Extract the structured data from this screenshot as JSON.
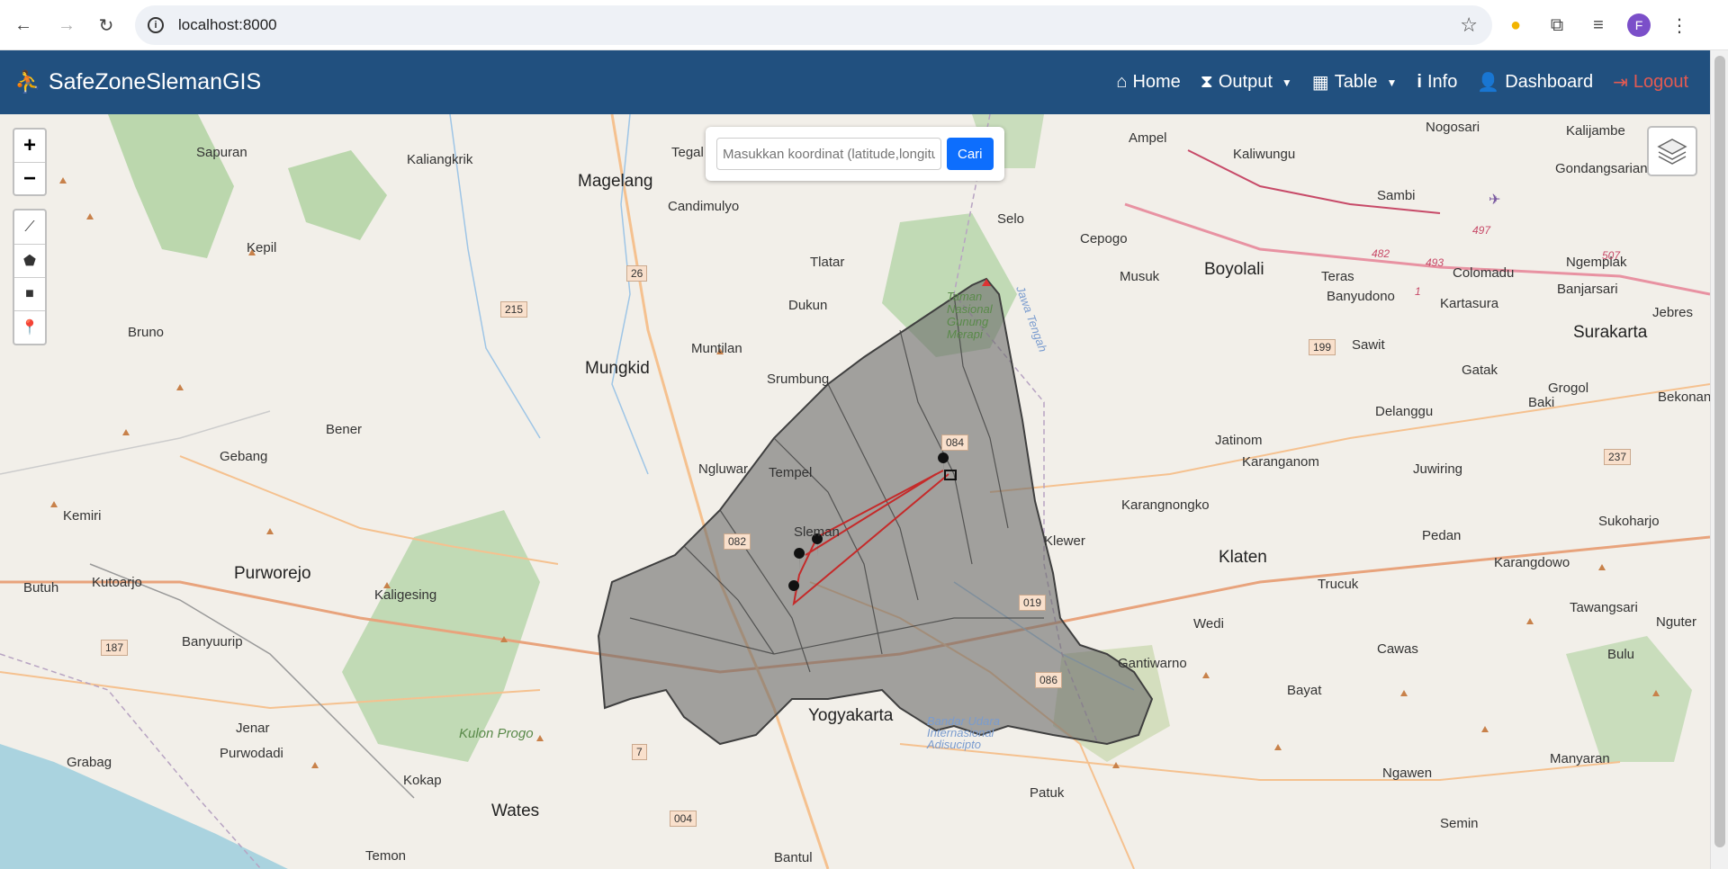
{
  "browser": {
    "url": "localhost:8000",
    "profile_initial": "F"
  },
  "navbar": {
    "brand": "SafeZoneSlemanGIS",
    "items": [
      {
        "label": "Home",
        "icon": "home-icon"
      },
      {
        "label": "Output",
        "icon": "hourglass-icon",
        "dropdown": true
      },
      {
        "label": "Table",
        "icon": "table-icon",
        "dropdown": true
      },
      {
        "label": "Info",
        "icon": "info-icon"
      },
      {
        "label": "Dashboard",
        "icon": "user-icon"
      },
      {
        "label": "Logout",
        "icon": "logout-icon"
      }
    ],
    "logout_color": "#e35a52",
    "bg_color": "#21507f"
  },
  "search": {
    "placeholder": "Masukkan koordinat (latitude,longitude)",
    "button": "Cari"
  },
  "map": {
    "zoom_in": "+",
    "zoom_out": "−",
    "labels": [
      "Sapuran",
      "Kaliangkrik",
      "Magelang",
      "Tegal",
      "Candimulyo",
      "Selo",
      "Cepogo",
      "Ampel",
      "Kaliwungu",
      "Nogosari",
      "Kalijambe",
      "Gondangsariangrejo",
      "Sambi",
      "Ngemplak",
      "Colomadu",
      "Banjarsari",
      "Jebres",
      "Surakarta",
      "Boyolali",
      "Teras",
      "Banyudono",
      "Kartasura",
      "Musuk",
      "Kepil",
      "Bruno",
      "Tlatar",
      "Dukun",
      "Mungkid",
      "Muntilan",
      "Srumbung",
      "Bener",
      "Gebang",
      "Kemiri",
      "Purworejo",
      "Kutoarjo",
      "Butuh",
      "Kaligesing",
      "Banyuurip",
      "Jenar",
      "Purwodadi",
      "Grabag",
      "Kokap",
      "Wates",
      "Temon",
      "Ngluwar",
      "Tempel",
      "Sleman",
      "Yogyakarta",
      "Bantul",
      "Patuk",
      "Jatinom",
      "Karanganom",
      "Karangnongko",
      "Klewer",
      "Klaten",
      "Delanggu",
      "Juwiring",
      "Pedan",
      "Trucuk",
      "Karangdowo",
      "Wedi",
      "Cawas",
      "Bayat",
      "Gantiwarno",
      "Tawangsari",
      "Sukoharjo",
      "Bulu",
      "Nguter",
      "Manyaran",
      "Ngawen",
      "Semin",
      "Sawit",
      "Gatak",
      "Grogol",
      "Baki",
      "Bekonang",
      "Taman Nasional Gunung Merapi",
      "Kulon Progo",
      "Bandar Udara Internasional Adisucipto",
      "Jawa Tengah"
    ],
    "road_numbers": [
      "26",
      "215",
      "199",
      "237",
      "187",
      "7",
      "004",
      "084",
      "082",
      "019",
      "086"
    ],
    "highway_numbers": [
      "497",
      "482",
      "493",
      "507",
      "1"
    ]
  }
}
